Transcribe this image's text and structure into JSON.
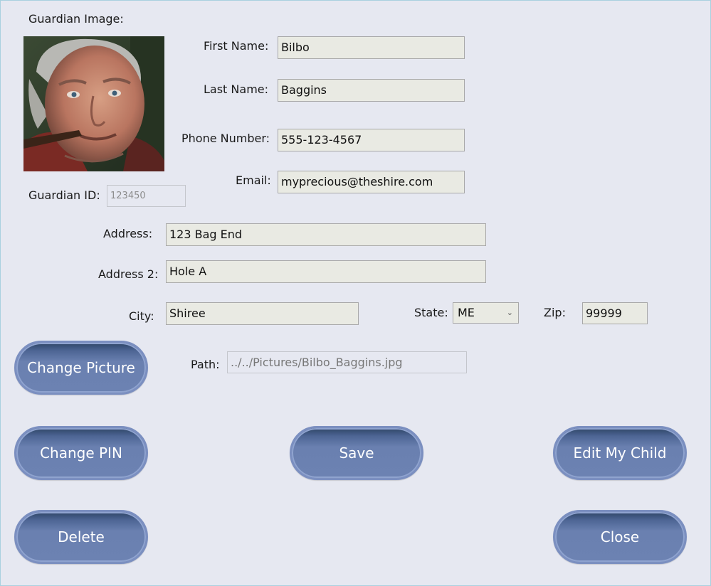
{
  "labels": {
    "guardian_image": "Guardian Image:",
    "first_name": "First Name:",
    "last_name": "Last Name:",
    "phone": "Phone Number:",
    "email": "Email:",
    "guardian_id": "Guardian ID:",
    "address": "Address:",
    "address2": "Address 2:",
    "city": "City:",
    "state": "State:",
    "zip": "Zip:",
    "path": "Path:"
  },
  "fields": {
    "first_name": "Bilbo",
    "last_name": "Baggins",
    "phone": "555-123-4567",
    "email": "myprecious@theshire.com",
    "guardian_id": "123450",
    "address": "123 Bag End",
    "address2": "Hole A",
    "city": "Shiree",
    "state": "ME",
    "zip": "99999",
    "path": "../../Pictures/Bilbo_Baggins.jpg"
  },
  "buttons": {
    "change_picture": "Change Picture",
    "change_pin": "Change PIN",
    "save": "Save",
    "edit_child": "Edit My Child",
    "delete": "Delete",
    "close": "Close"
  },
  "icons": {
    "state_dropdown": "chevron-down-icon"
  }
}
